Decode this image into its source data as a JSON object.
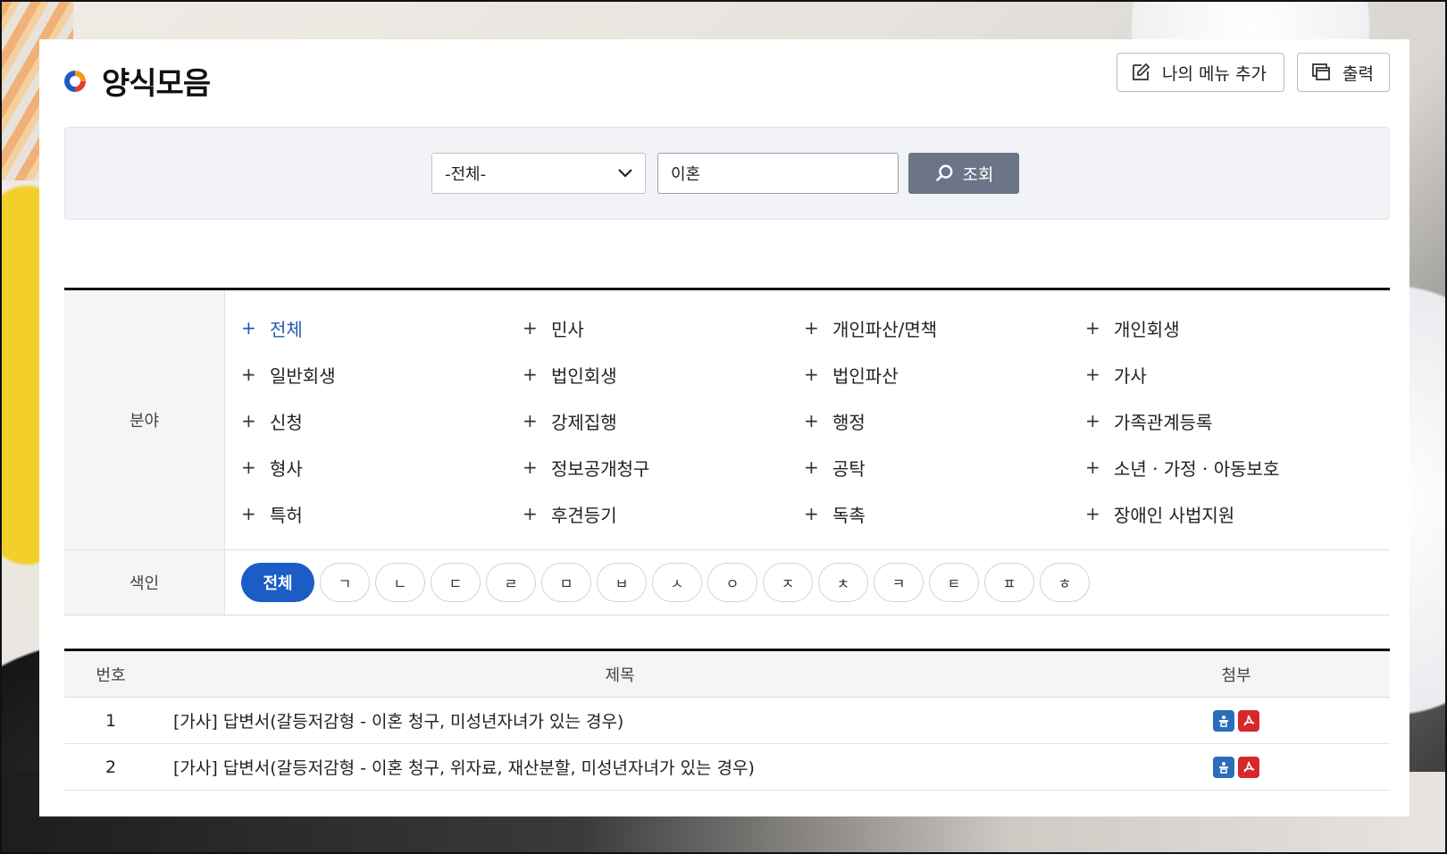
{
  "header": {
    "title": "양식모음",
    "my_menu_label": "나의 메뉴 추가",
    "print_label": "출력"
  },
  "search": {
    "category_selected": "-전체-",
    "keyword_value": "이혼",
    "search_label": "조회"
  },
  "filter": {
    "field_label": "분야",
    "fields": [
      "전체",
      "민사",
      "개인파산/면책",
      "개인회생",
      "일반회생",
      "법인회생",
      "법인파산",
      "가사",
      "신청",
      "강제집행",
      "행정",
      "가족관계등록",
      "형사",
      "정보공개청구",
      "공탁",
      "소년 · 가정 · 아동보호",
      "특허",
      "후견등기",
      "독촉",
      "장애인 사법지원"
    ],
    "index_label": "색인",
    "index_items": [
      "전체",
      "ㄱ",
      "ㄴ",
      "ㄷ",
      "ㄹ",
      "ㅁ",
      "ㅂ",
      "ㅅ",
      "ㅇ",
      "ㅈ",
      "ㅊ",
      "ㅋ",
      "ㅌ",
      "ㅍ",
      "ㅎ"
    ]
  },
  "list": {
    "col_no": "번호",
    "col_title": "제목",
    "col_attach": "첨부",
    "rows": [
      {
        "no": "1",
        "title": "[가사] 답변서(갈등저감형 - 이혼 청구, 미성년자녀가 있는 경우)"
      },
      {
        "no": "2",
        "title": "[가사] 답변서(갈등저감형 - 이혼 청구, 위자료, 재산분할, 미성년자녀가 있는 경우)"
      }
    ]
  },
  "colors": {
    "accent_blue": "#1c5cc7",
    "search_button": "#6c7587",
    "hwp_icon": "#2a6db8",
    "pdf_icon": "#d6282a"
  }
}
